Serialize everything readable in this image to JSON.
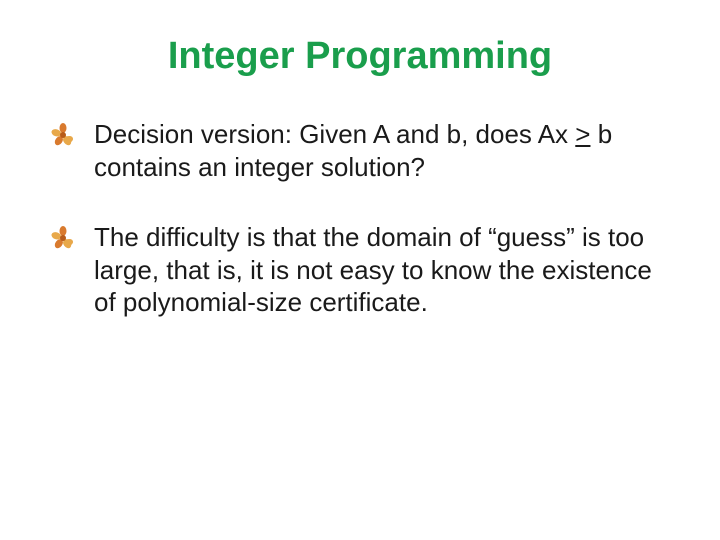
{
  "title": "Integer Programming",
  "bullets": [
    {
      "prefix": "Decision version: Given A and b, does Ax ",
      "underlined": ">",
      "suffix": " b contains an integer solution?"
    },
    {
      "prefix": "The difficulty is that the domain of “guess” is too large, that is, it is not easy to know the existence of polynomial-size certificate.",
      "underlined": "",
      "suffix": ""
    }
  ],
  "icon_name": "flower-bullet-icon"
}
